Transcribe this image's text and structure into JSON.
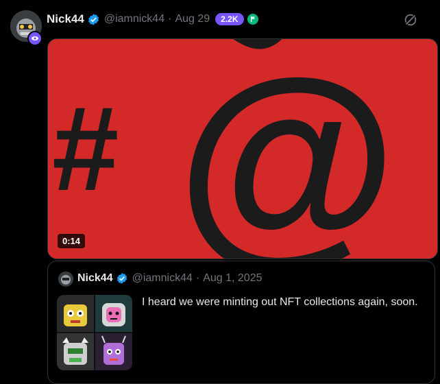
{
  "post": {
    "name": "Nick44",
    "handle": "@iamnick44",
    "separator": "·",
    "date": "Aug 29",
    "count_pill": "2.2K",
    "media": {
      "duration": "0:14",
      "background": "#d32a29",
      "hash_glyph": "#",
      "at_glyph": "@"
    }
  },
  "quote": {
    "name": "Nick44",
    "handle": "@iamnick44",
    "separator": "·",
    "date": "Aug 1, 2025",
    "text": "I heard we were minting out NFT collections again, soon."
  },
  "colors": {
    "accent": "#1d9bf0",
    "pill": "#7856ff",
    "muted": "#71767b"
  }
}
